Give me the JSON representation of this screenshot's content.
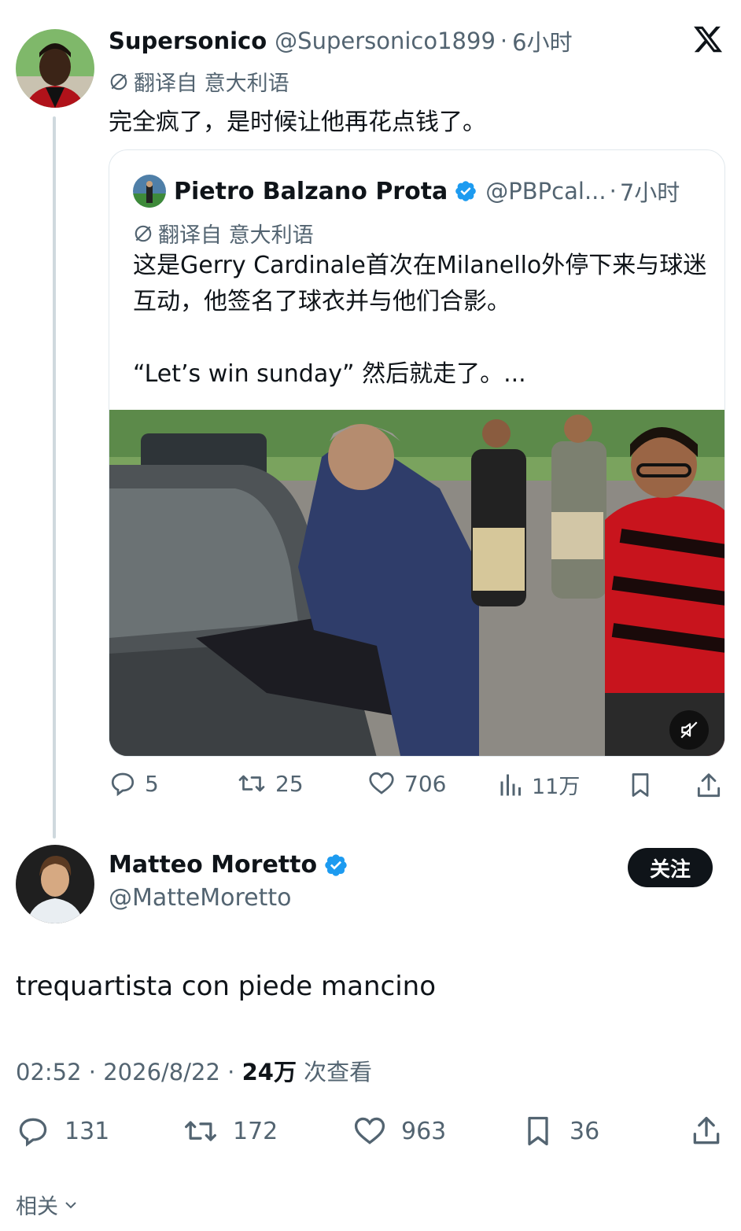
{
  "tweet_quote_parent": {
    "author_name": "Supersonico",
    "author_handle": "@Supersonico1899",
    "time": "6小时",
    "translate_label": "翻译自 意大利语",
    "text": "完全疯了，是时候让他再花点钱了。"
  },
  "quoted_tweet": {
    "author_name": "Pietro Balzano Prota",
    "author_handle": "@PBPcal...",
    "time": "7小时",
    "translate_label": "翻译自 意大利语",
    "text_line1": "这是Gerry Cardinale首次在Milanello外停下来与球迷互动，他签名了球衣并与他们合影。",
    "text_line2": "“Let’s win sunday” 然后就走了。...",
    "media_icon": "mute-icon"
  },
  "quote_actions": {
    "replies": "5",
    "retweets": "25",
    "likes": "706",
    "views": "11万"
  },
  "main_tweet": {
    "author_name": "Matteo Moretto",
    "author_handle": "@MatteMoretto",
    "follow_label": "关注",
    "text": "trequartista con piede mancino",
    "time": "02:52",
    "date": "2026/8/22",
    "views_count": "24万",
    "views_label": "次查看"
  },
  "main_actions": {
    "replies": "131",
    "retweets": "172",
    "likes": "963",
    "bookmarks": "36"
  },
  "footer": {
    "related_label": "相关"
  },
  "colors": {
    "verified": "#1d9bf0",
    "secondary_text": "#536471",
    "primary_text": "#0f1419",
    "thread_line": "#cfd9de"
  }
}
